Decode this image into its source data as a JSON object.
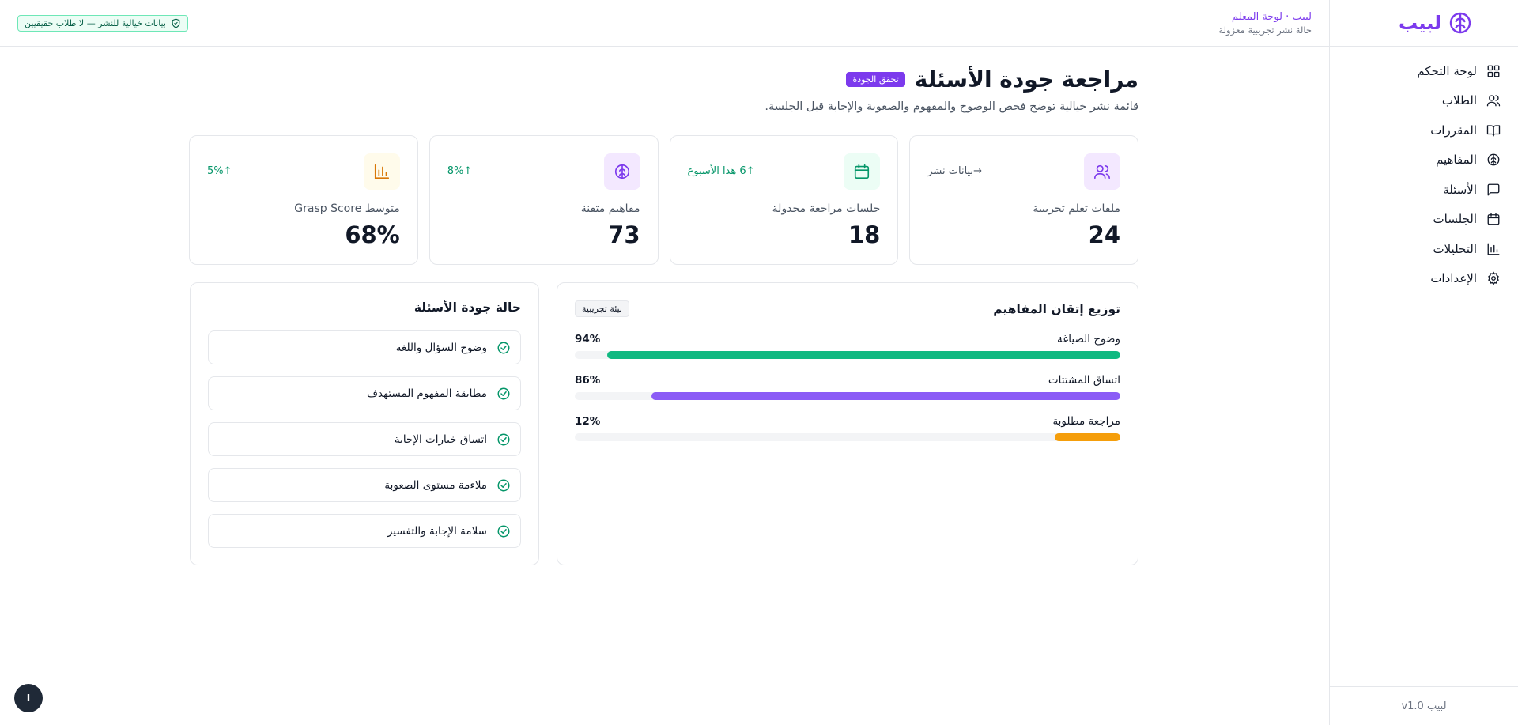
{
  "brand": {
    "name": "لبيب",
    "version": "لبيب v1.0"
  },
  "sidebar": {
    "items": [
      {
        "label": "لوحة التحكم",
        "icon": "dashboard-icon"
      },
      {
        "label": "الطلاب",
        "icon": "users-icon"
      },
      {
        "label": "المقررات",
        "icon": "book-icon"
      },
      {
        "label": "المفاهيم",
        "icon": "brain-icon"
      },
      {
        "label": "الأسئلة",
        "icon": "message-icon"
      },
      {
        "label": "الجلسات",
        "icon": "calendar-icon"
      },
      {
        "label": "التحليلات",
        "icon": "bar-chart-icon"
      },
      {
        "label": "الإعدادات",
        "icon": "gear-icon"
      }
    ]
  },
  "header": {
    "title": "لبيب · لوحة المعلم",
    "subtitle": "حالة نشر تجريبية معزولة",
    "notice": "بيانات خيالية للنشر — لا طلاب حقيقيين"
  },
  "page": {
    "title": "مراجعة جودة الأسئلة",
    "badge": "تحقق الجودة",
    "subtitle": "قائمة نشر خيالية توضح فحص الوضوح والمفهوم والصعوبة والإجابة قبل الجلسة."
  },
  "stats": [
    {
      "label": "ملفات تعلم تجريبية",
      "value": "24",
      "trend": "→بيانات نشر",
      "icon": "users-icon",
      "icon_color": "#7c3aed",
      "icon_bg": "#f3e8ff",
      "trend_color": "#4b5563"
    },
    {
      "label": "جلسات مراجعة مجدولة",
      "value": "18",
      "trend": "↑6 هذا الأسبوع",
      "icon": "calendar-icon",
      "icon_color": "#059669",
      "icon_bg": "#ecfdf5",
      "trend_color": "#059669"
    },
    {
      "label": "مفاهيم متقنة",
      "value": "73",
      "trend": "↑8%",
      "icon": "brain-icon",
      "icon_color": "#7c3aed",
      "icon_bg": "#f3e8ff",
      "trend_color": "#059669"
    },
    {
      "label": "متوسط Grasp Score",
      "value": "68%",
      "trend": "↑5%",
      "icon": "bar-chart-icon",
      "icon_color": "#d97706",
      "icon_bg": "#fffbeb",
      "trend_color": "#059669"
    }
  ],
  "mastery": {
    "title": "توزيع إتقان المفاهيم",
    "badge": "بيئة تجريبية",
    "bars": [
      {
        "label": "وضوح الصياغة",
        "percent_text": "94%",
        "value": 94,
        "color": "#10b981"
      },
      {
        "label": "اتساق المشتتات",
        "percent_text": "86%",
        "value": 86,
        "color": "#8b5cf6"
      },
      {
        "label": "مراجعة مطلوبة",
        "percent_text": "12%",
        "value": 12,
        "color": "#f59e0b"
      }
    ]
  },
  "quality": {
    "title": "حالة جودة الأسئلة",
    "items": [
      "وضوح السؤال واللغة",
      "مطابقة المفهوم المستهدف",
      "اتساق خيارات الإجابة",
      "ملاءمة مستوى الصعوبة",
      "سلامة الإجابة والتفسير"
    ]
  },
  "fab": {
    "label": "I"
  },
  "colors": {
    "accent": "#7c3aed",
    "success": "#059669",
    "warning": "#f59e0b"
  }
}
